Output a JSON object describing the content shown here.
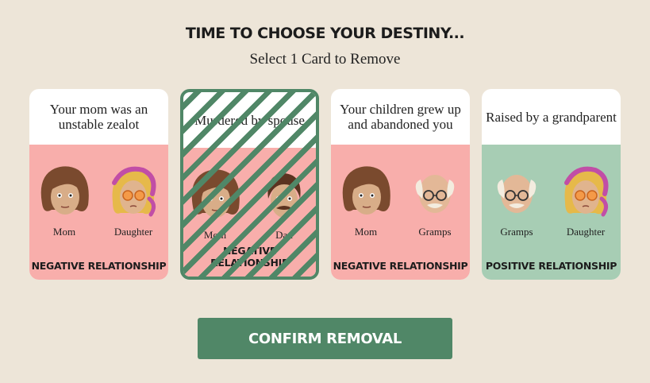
{
  "header": {
    "title": "TIME TO CHOOSE YOUR DESTINY...",
    "subtitle": "Select 1 Card to Remove"
  },
  "cards": [
    {
      "text": "Your mom was an unstable zealot",
      "left_person": "Mom",
      "right_person": "Daughter",
      "relationship": "NEGATIVE RELATIONSHIP",
      "selected": false
    },
    {
      "text": "Murdered by spouse",
      "left_person": "Mom",
      "right_person": "Dad",
      "relationship": "NEGATIVE RELATIONSHIP",
      "selected": true
    },
    {
      "text": "Your children grew up and abandoned you",
      "left_person": "Mom",
      "right_person": "Gramps",
      "relationship": "NEGATIVE RELATIONSHIP",
      "selected": false
    },
    {
      "text": "Raised by a grandparent",
      "left_person": "Gramps",
      "right_person": "Daughter",
      "relationship": "POSITIVE RELATIONSHIP",
      "selected": false
    }
  ],
  "confirm_label": "CONFIRM REMOVAL",
  "colors": {
    "background": "#ede5d8",
    "accent_green": "#508767",
    "negative_card": "#f8aeab",
    "positive_card": "#a7cdb4"
  },
  "icons": {
    "mom": "mom-portrait-icon",
    "daughter": "daughter-portrait-icon",
    "dad": "dad-portrait-icon",
    "gramps": "gramps-portrait-icon"
  }
}
